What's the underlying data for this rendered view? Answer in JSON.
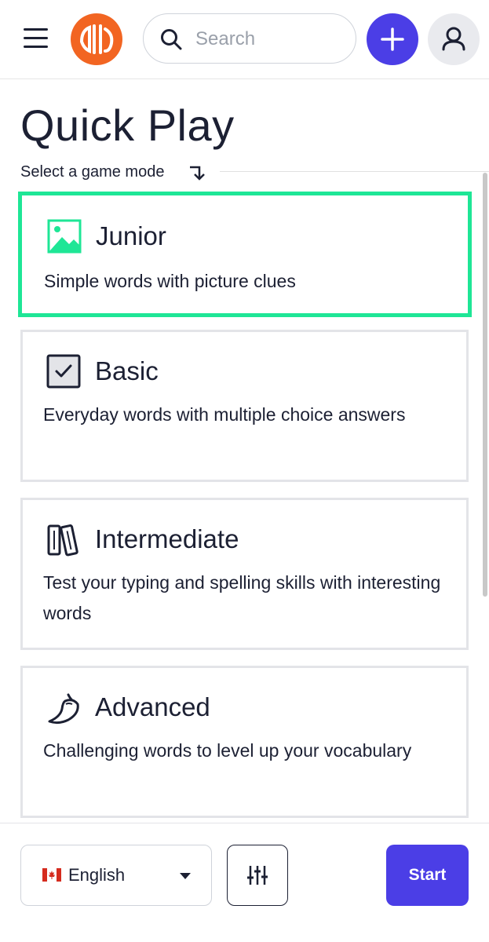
{
  "header": {
    "search_placeholder": "Search"
  },
  "page": {
    "title": "Quick Play",
    "subtitle": "Select a game mode"
  },
  "modes": [
    {
      "title": "Junior",
      "description": "Simple words with picture clues",
      "icon": "image-icon",
      "selected": true
    },
    {
      "title": "Basic",
      "description": "Everyday words with multiple choice answers",
      "icon": "checkbox-icon",
      "selected": false
    },
    {
      "title": "Intermediate",
      "description": "Test your typing and spelling skills with interesting words",
      "icon": "books-icon",
      "selected": false
    },
    {
      "title": "Advanced",
      "description": "Challenging words to level up your vocabulary",
      "icon": "chili-pepper-icon",
      "selected": false
    }
  ],
  "footer": {
    "language": "English",
    "language_flag": "canada-flag-icon",
    "start_label": "Start"
  },
  "colors": {
    "accent": "#4b3ee6",
    "logo": "#f26522",
    "selected_border": "#1ee696",
    "text": "#1c2033"
  }
}
